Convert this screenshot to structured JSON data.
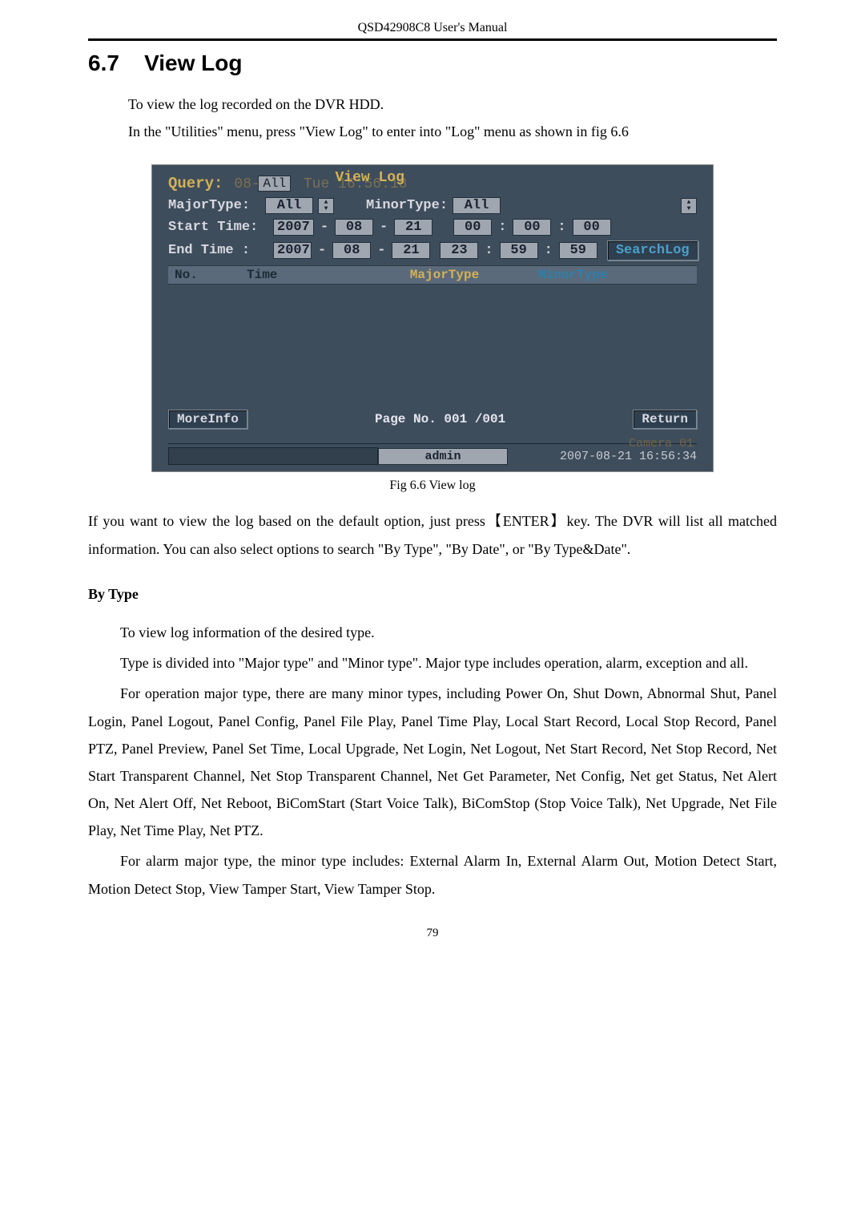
{
  "header": "QSD42908C8 User's Manual",
  "section": {
    "number": "6.7",
    "title": "View Log"
  },
  "intro": {
    "line1": "To view the log recorded on the DVR HDD.",
    "line2": "In the \"Utilities\" menu, press \"View Log\" to enter into \"Log\" menu as shown in fig 6.6"
  },
  "figure": {
    "query_label": "Query:",
    "overlay_all": "All",
    "title": "View Log",
    "major_label": "MajorType:",
    "major_value": "All",
    "minor_label": "MinorType:",
    "minor_value": "All",
    "start_label": "Start Time:",
    "end_label": "End Time  :",
    "start": {
      "y": "2007",
      "mo": "08",
      "d": "21",
      "hh": "00",
      "mm": "00",
      "ss": "00"
    },
    "end": {
      "y": "2007",
      "mo": "08",
      "d": "21",
      "hh": "23",
      "mm": "59",
      "ss": "59"
    },
    "search_btn": "SearchLog",
    "headers": {
      "no": "No.",
      "time": "Time",
      "major": "MajorType",
      "minor": "MinorType"
    },
    "moreinfo_btn": "MoreInfo",
    "page_no": "Page No. 001 /001",
    "return_btn": "Return",
    "status_user": "admin",
    "status_ghost": "Camera 01",
    "status_time": "2007-08-21 16:56:34"
  },
  "caption": "Fig 6.6 View log",
  "para1": "If you want to view the log based on the default option, just press【ENTER】key. The DVR will list all matched information. You can also select options to search \"By Type\", \"By Date\", or \"By Type&Date\".",
  "bytype_header": "By Type",
  "bytype": {
    "p1": "To view log information of the desired type.",
    "p2": "Type is divided into \"Major type\" and \"Minor type\". Major type includes operation, alarm, exception and all.",
    "p3": "For operation major type, there are many minor types, including Power On, Shut Down, Abnormal Shut, Panel Login, Panel Logout, Panel Config, Panel File Play, Panel Time Play, Local Start Record, Local Stop Record, Panel PTZ, Panel Preview, Panel Set Time, Local Upgrade, Net Login, Net Logout, Net Start Record, Net Stop Record, Net Start Transparent Channel, Net Stop Transparent Channel, Net Get Parameter, Net Config, Net get Status, Net Alert On, Net Alert Off, Net Reboot, BiComStart (Start Voice Talk), BiComStop (Stop Voice Talk), Net Upgrade, Net File Play, Net Time Play, Net PTZ.",
    "p4": "For alarm major type, the minor type includes: External Alarm In, External Alarm Out, Motion Detect Start, Motion Detect Stop, View Tamper Start, View Tamper Stop."
  },
  "page_number": "79"
}
